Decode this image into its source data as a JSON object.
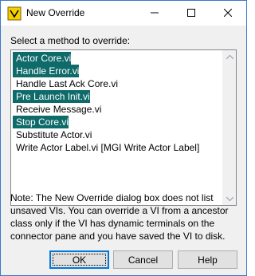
{
  "window": {
    "title": "New Override",
    "icon": "labview-override-icon"
  },
  "titlebar_buttons": {
    "minimize_icon": "minimize-icon",
    "maximize_icon": "maximize-icon",
    "close_icon": "close-icon"
  },
  "prompt": "Select a method to override:",
  "methods": [
    {
      "label": "Actor Core.vi",
      "selected": true
    },
    {
      "label": "Handle Error.vi",
      "selected": true
    },
    {
      "label": "Handle Last Ack Core.vi",
      "selected": false
    },
    {
      "label": "Pre Launch Init.vi",
      "selected": true
    },
    {
      "label": "Receive Message.vi",
      "selected": false
    },
    {
      "label": "Stop Core.vi",
      "selected": true
    },
    {
      "label": "Substitute Actor.vi",
      "selected": false
    },
    {
      "label": "Write Actor Label.vi [MGI Write Actor Label]",
      "selected": false
    }
  ],
  "note": "Note: The New Override dialog box does not list unsaved VIs. You can override a VI from a ancestor class only if the VI has dynamic terminals on the connector pane and you have saved the VI to disk.",
  "buttons": {
    "ok": "OK",
    "cancel": "Cancel",
    "help": "Help"
  },
  "colors": {
    "selection": "#0f6a6a",
    "focus_border": "#0078d7"
  }
}
